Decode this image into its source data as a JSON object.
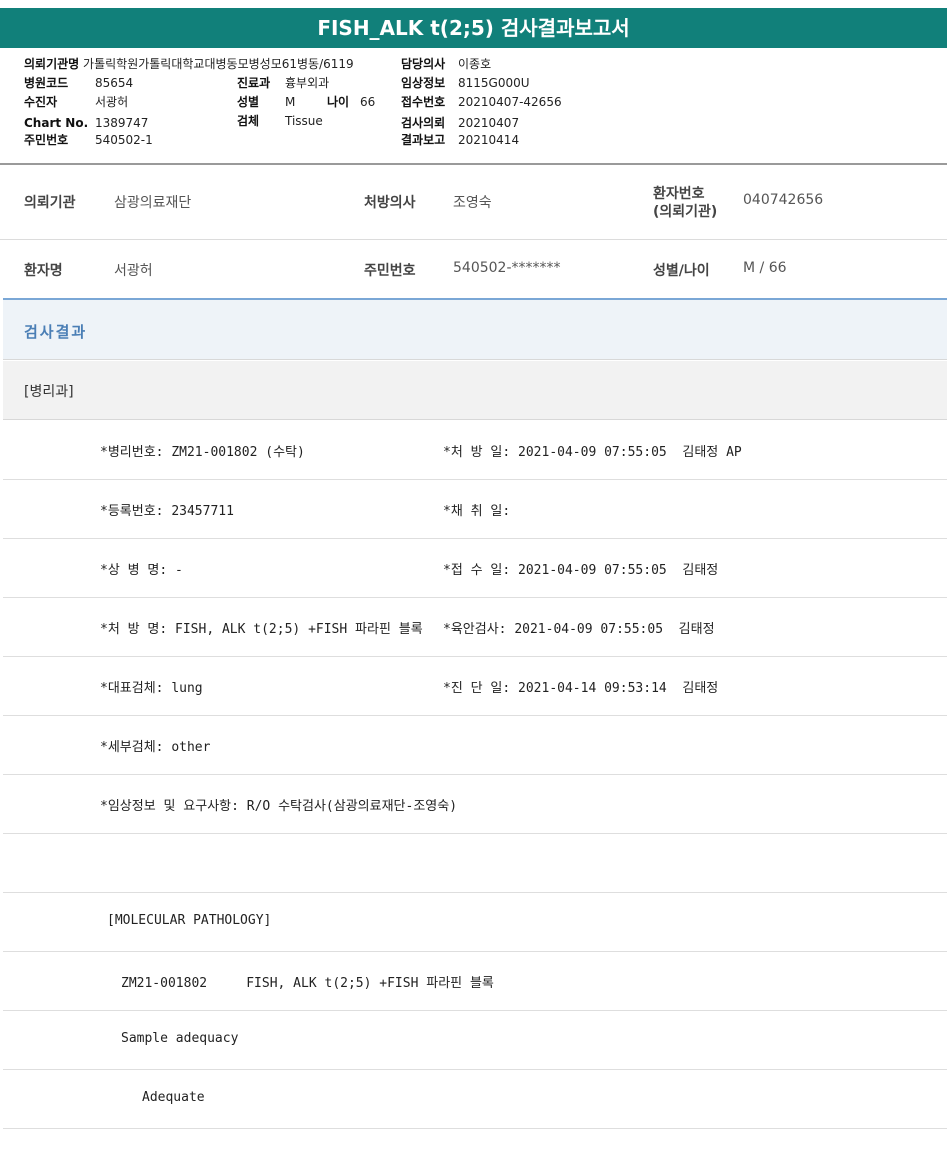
{
  "title": "FISH_ALK t(2;5) 검사결과보고서",
  "header": {
    "col1": [
      {
        "key": "의뢰기관명",
        "value": "가톨릭학원가톨릭대학교대병동모병성모61병동/6119"
      },
      {
        "key": "병원코드",
        "value": "85654"
      },
      {
        "key": "수진자",
        "value": "서광허"
      },
      {
        "key": "Chart No.",
        "value": "1389747"
      },
      {
        "key": "주민번호",
        "value": "540502-1"
      }
    ],
    "col2": [
      {
        "key": "진료과",
        "value": "흉부외과"
      },
      {
        "key": "성별",
        "value": "M"
      },
      {
        "key": "나이",
        "value": "66"
      },
      {
        "key": "검체",
        "value": "Tissue"
      }
    ],
    "col3": [
      {
        "key": "담당의사",
        "value": "이종호"
      },
      {
        "key": "임상정보",
        "value": "8115G000U"
      },
      {
        "key": "접수번호",
        "value": "20210407-42656"
      },
      {
        "key": "검사의뢰",
        "value": "20210407"
      },
      {
        "key": "결과보고",
        "value": "20210414"
      }
    ]
  },
  "info_row1": {
    "institution_label": "의뢰기관",
    "institution_value": "삼광의료재단",
    "doctor_label": "처방의사",
    "doctor_value": "조영숙",
    "patient_no_label_1": "환자번호",
    "patient_no_label_2": "(의뢰기관)",
    "patient_no_value": "040742656"
  },
  "info_row2": {
    "name_label": "환자명",
    "name_value": "서광허",
    "rrn_label": "주민번호",
    "rrn_value": "540502-*******",
    "sexage_label": "성별/나이",
    "sexage_value": "M / 66"
  },
  "section_title": "검사결과",
  "sub_title": "[병리과]",
  "rows": [
    {
      "left": "*병리번호: ZM21-001802 (수탁)",
      "right": "*처 방 일: 2021-04-09 07:55:05  김태정 AP"
    },
    {
      "left": "*등록번호: 23457711",
      "right": "*채 취 일:"
    },
    {
      "left": "*상 병 명: -",
      "right": "*접 수 일: 2021-04-09 07:55:05  김태정"
    },
    {
      "left": "*처 방 명: FISH, ALK t(2;5) +FISH 파라핀 블록",
      "right": "*육안검사: 2021-04-09 07:55:05  김태정"
    },
    {
      "left": "*대표검체: lung",
      "right": "*진 단 일: 2021-04-14 09:53:14  김태정"
    },
    {
      "left": "*세부검체: other",
      "right": ""
    },
    {
      "left": "*임상정보 및 요구사항: R/O 수탁검사(삼광의료재단-조영숙)",
      "right": ""
    },
    {
      "left": "",
      "right": ""
    }
  ],
  "body_rows": [
    "[MOLECULAR PATHOLOGY]",
    "ZM21-001802     FISH, ALK t(2;5) +FISH 파라핀 블록",
    "Sample adequacy",
    "Adequate"
  ]
}
